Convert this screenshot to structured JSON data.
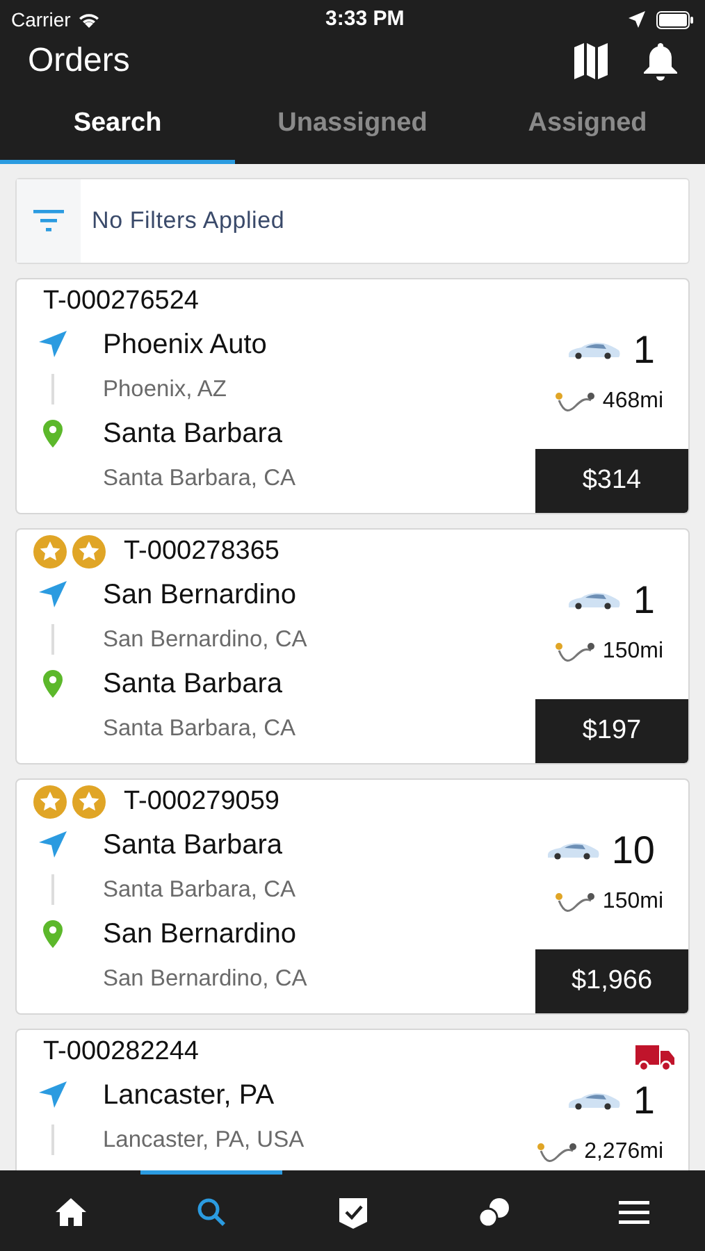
{
  "status_bar": {
    "carrier": "Carrier",
    "time": "3:33 PM"
  },
  "header": {
    "title": "Orders"
  },
  "tabs": [
    {
      "label": "Search",
      "selected": true
    },
    {
      "label": "Unassigned",
      "selected": false
    },
    {
      "label": "Assigned",
      "selected": false
    }
  ],
  "filter": {
    "label": "No Filters Applied"
  },
  "orders": [
    {
      "id": "T-000276524",
      "origin_name": "Phoenix Auto",
      "origin_address": "Phoenix, AZ",
      "destination_name": "Santa Barbara",
      "destination_address": "Santa Barbara, CA",
      "vehicles": "1",
      "distance": "468mi",
      "price": "$314"
    },
    {
      "id": "T-000278365",
      "badges": [
        {
          "kind": "star"
        },
        {
          "kind": "star"
        }
      ],
      "origin_name": "San Bernardino",
      "origin_address": "San Bernardino, CA",
      "destination_name": "Santa Barbara",
      "destination_address": "Santa Barbara, CA",
      "vehicles": "1",
      "distance": "150mi",
      "price": "$197"
    },
    {
      "id": "T-000279059",
      "badges": [
        {
          "kind": "star"
        },
        {
          "kind": "star"
        }
      ],
      "origin_name": "Santa Barbara",
      "origin_address": "Santa Barbara, CA",
      "destination_name": "San Bernardino",
      "destination_address": "San Bernardino, CA",
      "vehicles": "10",
      "distance": "150mi",
      "price": "$1,966"
    },
    {
      "id": "T-000282244",
      "truck": true,
      "origin_name": "Lancaster, PA",
      "origin_address": "Lancaster, PA, USA",
      "vehicles": "1",
      "distance": "2,276mi"
    }
  ],
  "bottom_nav": [
    {
      "kind": "home",
      "selected": false
    },
    {
      "kind": "search",
      "selected": true
    },
    {
      "kind": "tasks",
      "selected": false
    },
    {
      "kind": "messages",
      "selected": false
    },
    {
      "kind": "menu",
      "selected": false
    }
  ]
}
